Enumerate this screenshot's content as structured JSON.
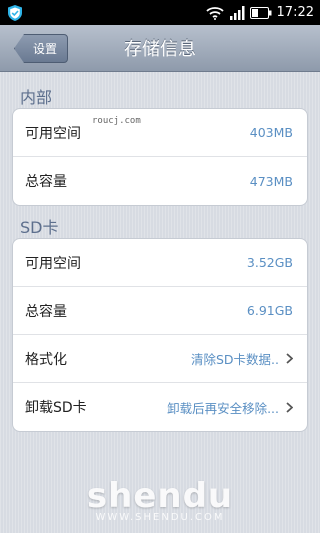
{
  "status_bar": {
    "time": "17:22",
    "icons": [
      "shield-icon",
      "wifi-icon",
      "signal-icon",
      "battery-icon"
    ]
  },
  "nav": {
    "back_label": "设置",
    "title": "存储信息"
  },
  "sections": [
    {
      "header": "内部",
      "rows": [
        {
          "label": "可用空间",
          "value": "403MB"
        },
        {
          "label": "总容量",
          "value": "473MB"
        }
      ]
    },
    {
      "header": "SD卡",
      "rows": [
        {
          "label": "可用空间",
          "value": "3.52GB"
        },
        {
          "label": "总容量",
          "value": "6.91GB"
        },
        {
          "label": "格式化",
          "value": "清除SD卡数据..",
          "chevron": true
        },
        {
          "label": "卸载SD卡",
          "value": "卸载后再安全移除...",
          "chevron": true
        }
      ]
    }
  ],
  "watermarks": {
    "small": "roucj.com",
    "brand": "shendu",
    "brand_url": "WWW.SHENDU.COM"
  },
  "colors": {
    "accent_value": "#5a8fc3",
    "section_header": "#5d6f8d",
    "nav_bar": "#a3adbc"
  }
}
